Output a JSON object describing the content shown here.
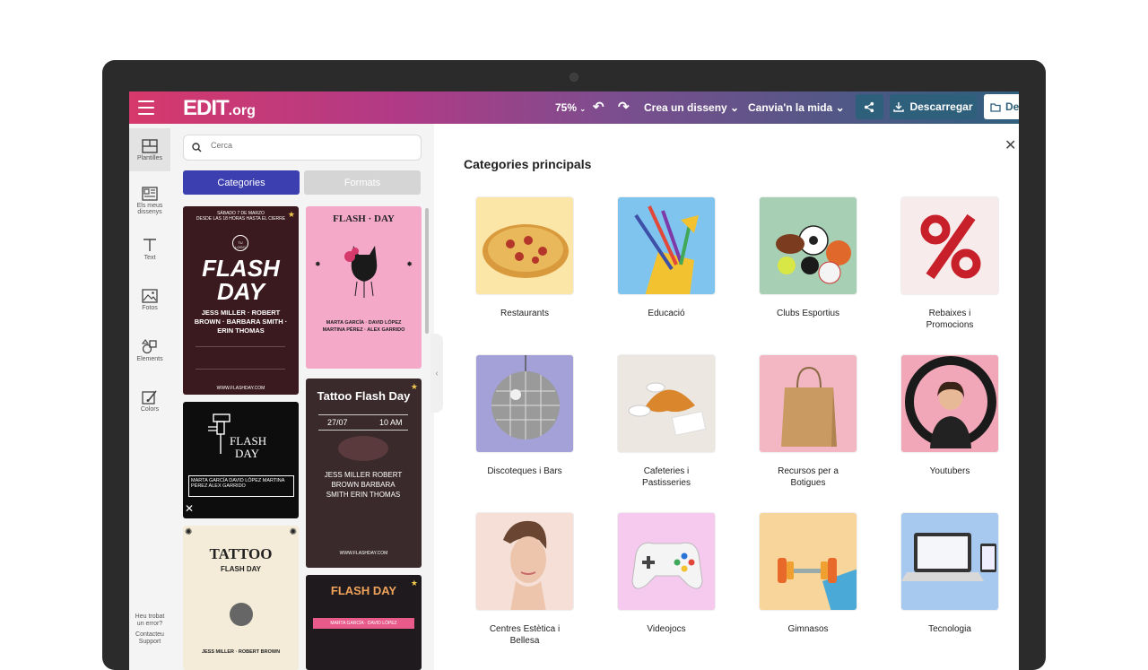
{
  "app": {
    "logo_main": "EDIT",
    "logo_suffix": ".org",
    "zoom": "75%",
    "create_design": "Crea un disseny",
    "resize": "Canvia'n la mida",
    "download": "Descarregar",
    "folder_btn": "De"
  },
  "rail": {
    "templates": "Plantilles",
    "my_designs_1": "Els meus",
    "my_designs_2": "dissenys",
    "text": "Text",
    "photos": "Fotos",
    "elements": "Elements",
    "colors": "Colors",
    "help_1": "Heu trobat",
    "help_2": "un error?",
    "support_1": "Contacteu",
    "support_2": "Support"
  },
  "panel": {
    "search_placeholder": "Cerca",
    "tab_categories": "Categories",
    "tab_formats": "Formats"
  },
  "templates": {
    "t1": {
      "top": "SÁBADO 7 DE MARZO",
      "top2": "DESDE LAS 18 HORAS HASTA EL CIERRE",
      "logo": "TU LOGO",
      "title1": "FLASH",
      "title2": "DAY",
      "names": "JESS MILLER · ROBERT BROWN · BARBARA SMITH · ERIN THOMAS",
      "url": "WWW.FLASHDAY.COM"
    },
    "t2": {
      "title": "FLASH · DAY",
      "names": "MARTA GARCÍA · DAVID LÓPEZ MARTINA PÉREZ · ALEX GARRIDO"
    },
    "t3": {
      "title1": "FLASH",
      "title2": "DAY",
      "names": "MARTA GARCÍA DAVID LÓPEZ MARTINA PÉREZ ALEX GARRIDO"
    },
    "t4": {
      "title": "Tattoo Flash Day",
      "date": "27/07",
      "time": "10 AM",
      "names": "JESS MILLER ROBERT BROWN BARBARA SMITH ERIN THOMAS",
      "url": "WWW.FLASHDAY.COM"
    },
    "t5": {
      "title1": "TATTOO",
      "title2": "FLASH DAY",
      "names": "JESS MILLER · ROBERT BROWN"
    },
    "t6": {
      "title": "FLASH DAY",
      "names": "MARTA GARCÍA · DAVID LÓPEZ"
    }
  },
  "main": {
    "title": "Categories principals",
    "categories": [
      {
        "l1": "Restaurants",
        "l2": ""
      },
      {
        "l1": "Educació",
        "l2": ""
      },
      {
        "l1": "Clubs Esportius",
        "l2": ""
      },
      {
        "l1": "Rebaixes i",
        "l2": "Promocions"
      },
      {
        "l1": "Discoteques i Bars",
        "l2": ""
      },
      {
        "l1": "Cafeteries i",
        "l2": "Pastisseries"
      },
      {
        "l1": "Recursos per a",
        "l2": "Botigues"
      },
      {
        "l1": "Youtubers",
        "l2": ""
      },
      {
        "l1": "Centres Estètica i",
        "l2": "Bellesa"
      },
      {
        "l1": "Videojocs",
        "l2": ""
      },
      {
        "l1": "Gimnasos",
        "l2": ""
      },
      {
        "l1": "Tecnologia",
        "l2": ""
      }
    ]
  }
}
